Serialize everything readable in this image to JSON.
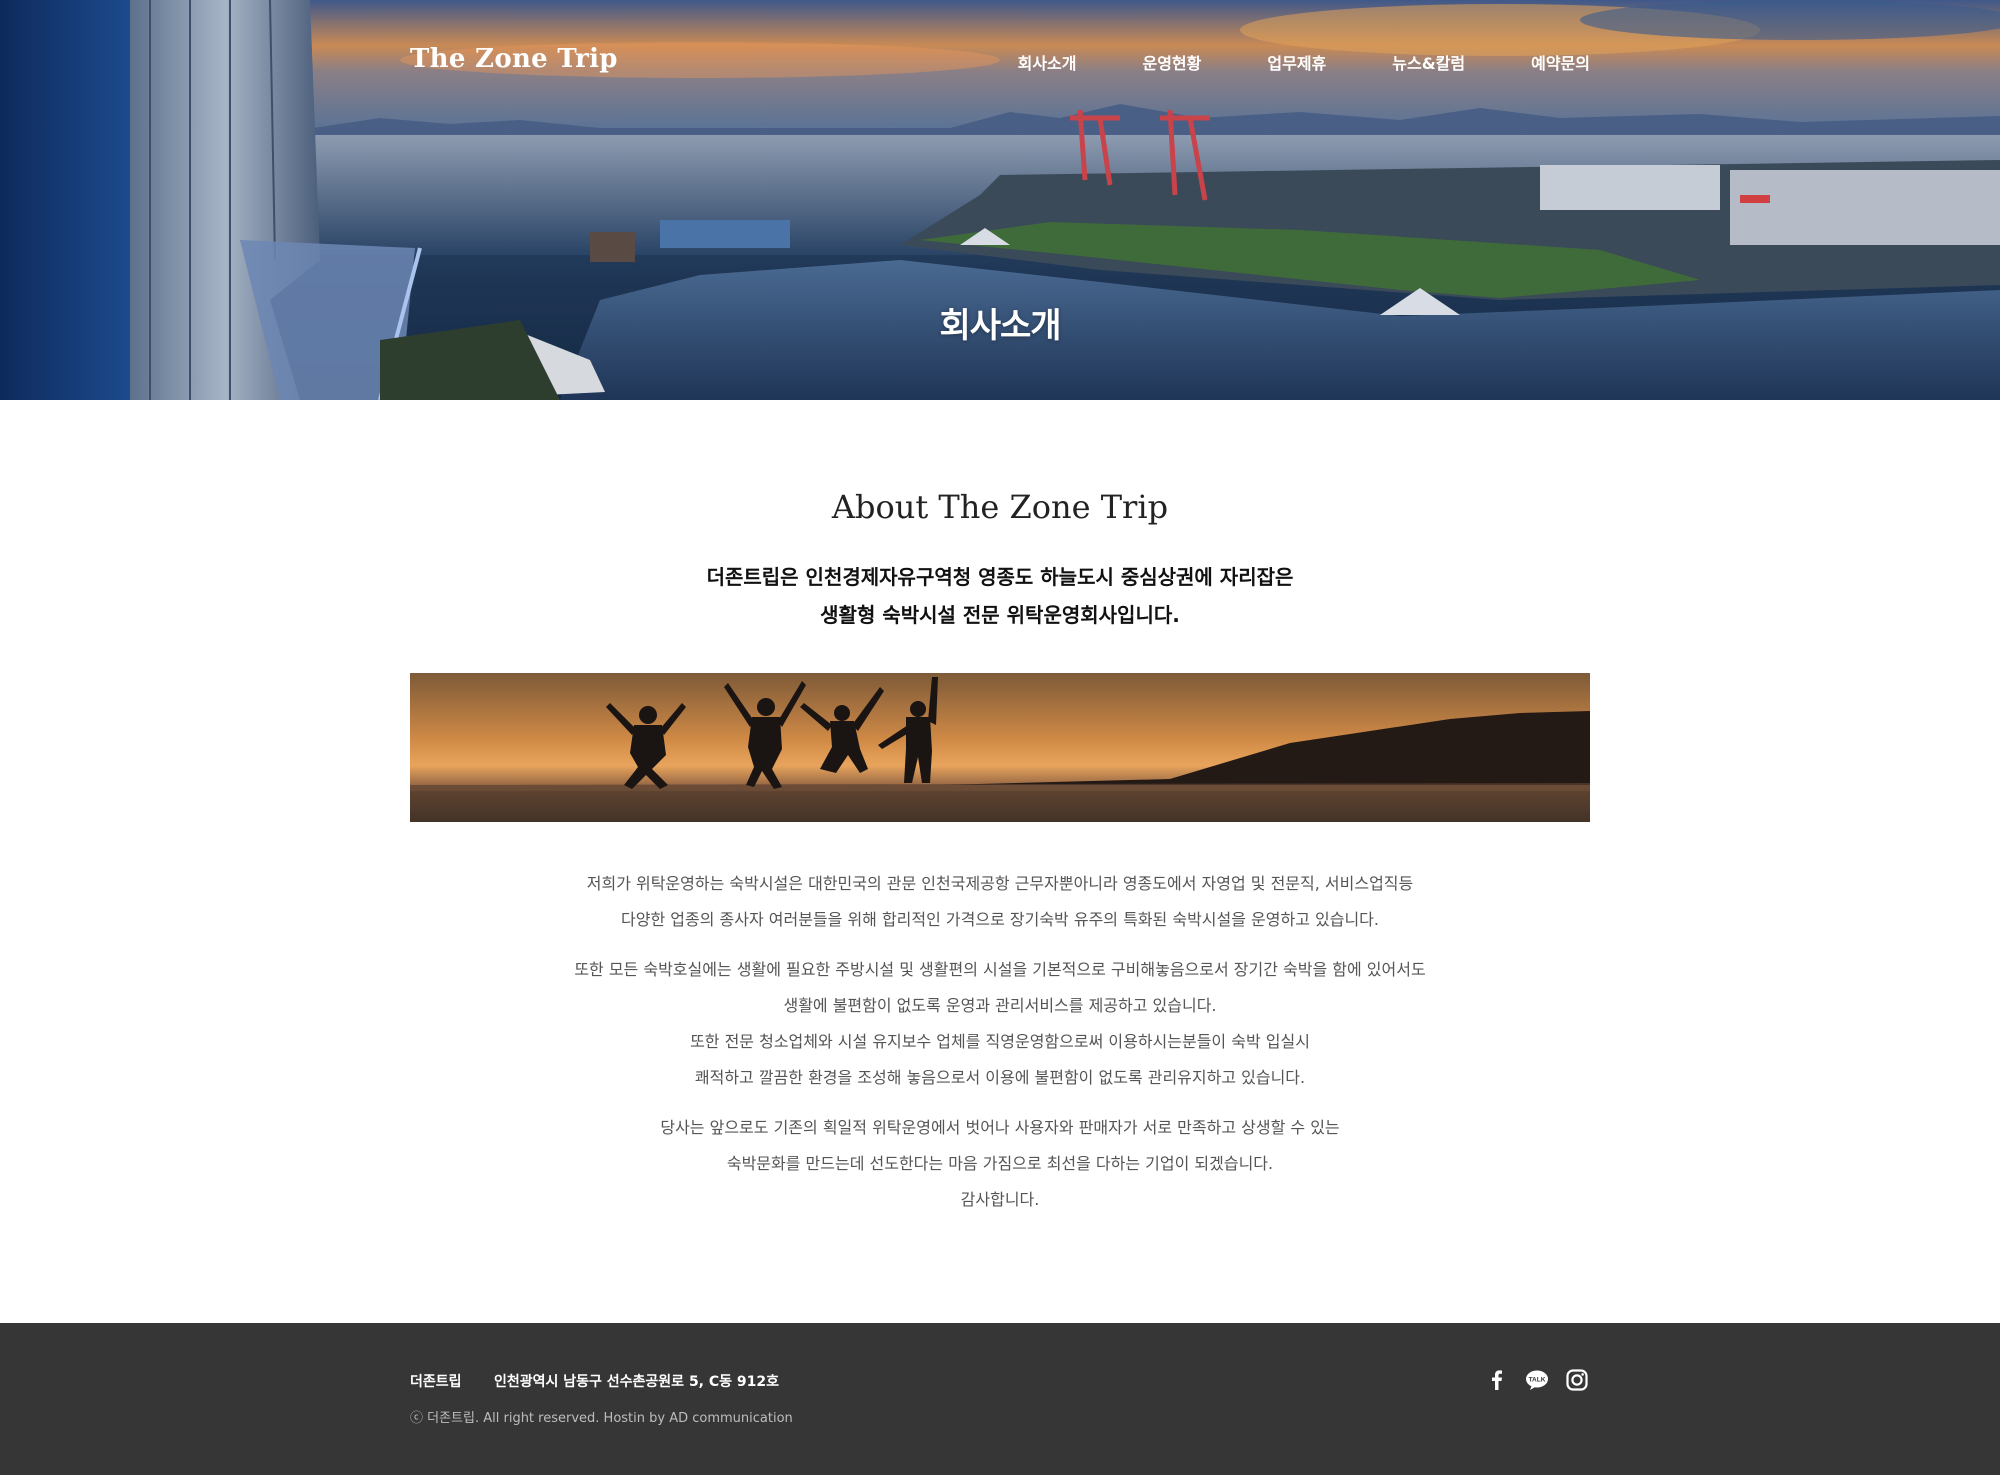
{
  "header": {
    "logo": "The Zone Trip",
    "nav": [
      "회사소개",
      "운영현황",
      "업무제휴",
      "뉴스&칼럼",
      "예약문의"
    ]
  },
  "hero": {
    "title": "회사소개"
  },
  "about": {
    "title": "About The Zone Trip",
    "intro_lines": [
      "더존트립은 인천경제자유구역청 영종도 하늘도시 중심상권에 자리잡은",
      "생활형 숙박시설 전문 위탁운영회사입니다."
    ],
    "paragraph1": [
      "저희가 위탁운영하는 숙박시설은 대한민국의 관문 인천국제공항 근무자뿐아니라 영종도에서 자영업 및 전문직, 서비스업직등",
      "다양한 업종의 종사자 여러분들을 위해 합리적인 가격으로 장기숙박 유주의 특화된 숙박시설을 운영하고 있습니다."
    ],
    "paragraph2": [
      "또한 모든 숙박호실에는 생활에 필요한 주방시설 및 생활편의 시설을 기본적으로 구비해놓음으로서 장기간 숙박을 함에 있어서도",
      "생활에 불편함이 없도록 운영과 관리서비스를 제공하고 있습니다.",
      "또한 전문 청소업체와 시설 유지보수 업체를 직영운영함으로써 이용하시는분들이 숙박 입실시",
      "쾌적하고 깔끔한 환경을 조성해 놓음으로서 이용에 불편함이 없도록 관리유지하고 있습니다."
    ],
    "paragraph3": [
      "당사는 앞으로도 기존의 획일적 위탁운영에서 벗어나 사용자와 판매자가 서로 만족하고 상생할 수 있는",
      "숙박문화를 만드는데 선도한다는 마음 가짐으로 최선을 다하는 기업이 되겠습니다.",
      "감사합니다."
    ]
  },
  "footer": {
    "company": "더존트립",
    "address": "인천광역시 남동구 선수촌공원로 5, C동 912호",
    "copyright": "ⓒ 더존트립. All right reserved. Hostin by AD communication",
    "social_icons": [
      "facebook-icon",
      "kakaotalk-icon",
      "instagram-icon"
    ],
    "kakao_label": "TALK"
  }
}
